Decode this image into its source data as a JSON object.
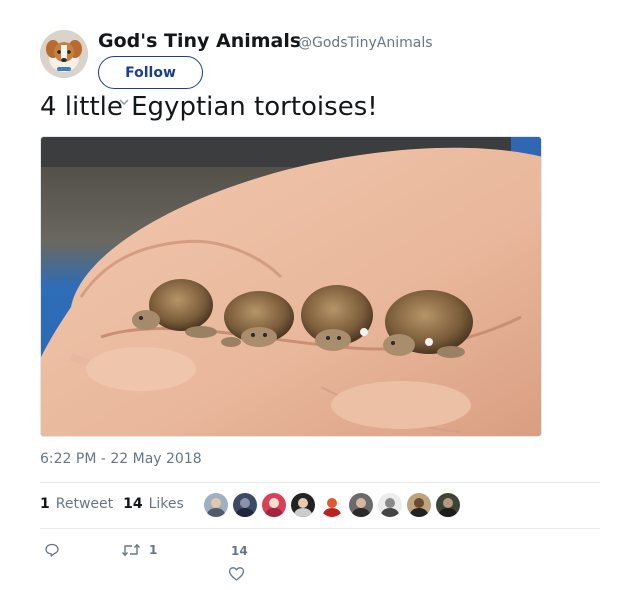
{
  "user": {
    "name": "God's Tiny Animals",
    "handle": "@GodsTinyAnimals",
    "follow_label": "Follow"
  },
  "tweet": {
    "text": "4 little Egyptian tortoises!",
    "timestamp": "6:22 PM - 22 May 2018"
  },
  "stats": {
    "retweets_count": "1",
    "retweets_label": "Retweet",
    "likes_count": "14",
    "likes_label": "Likes"
  },
  "actions": {
    "retweet_count": "1",
    "like_count": "14"
  },
  "colors": {
    "follow_border": "#1b3e8f",
    "muted_text": "#657786"
  },
  "icons": [
    "reply-icon",
    "retweet-icon",
    "like-icon"
  ]
}
